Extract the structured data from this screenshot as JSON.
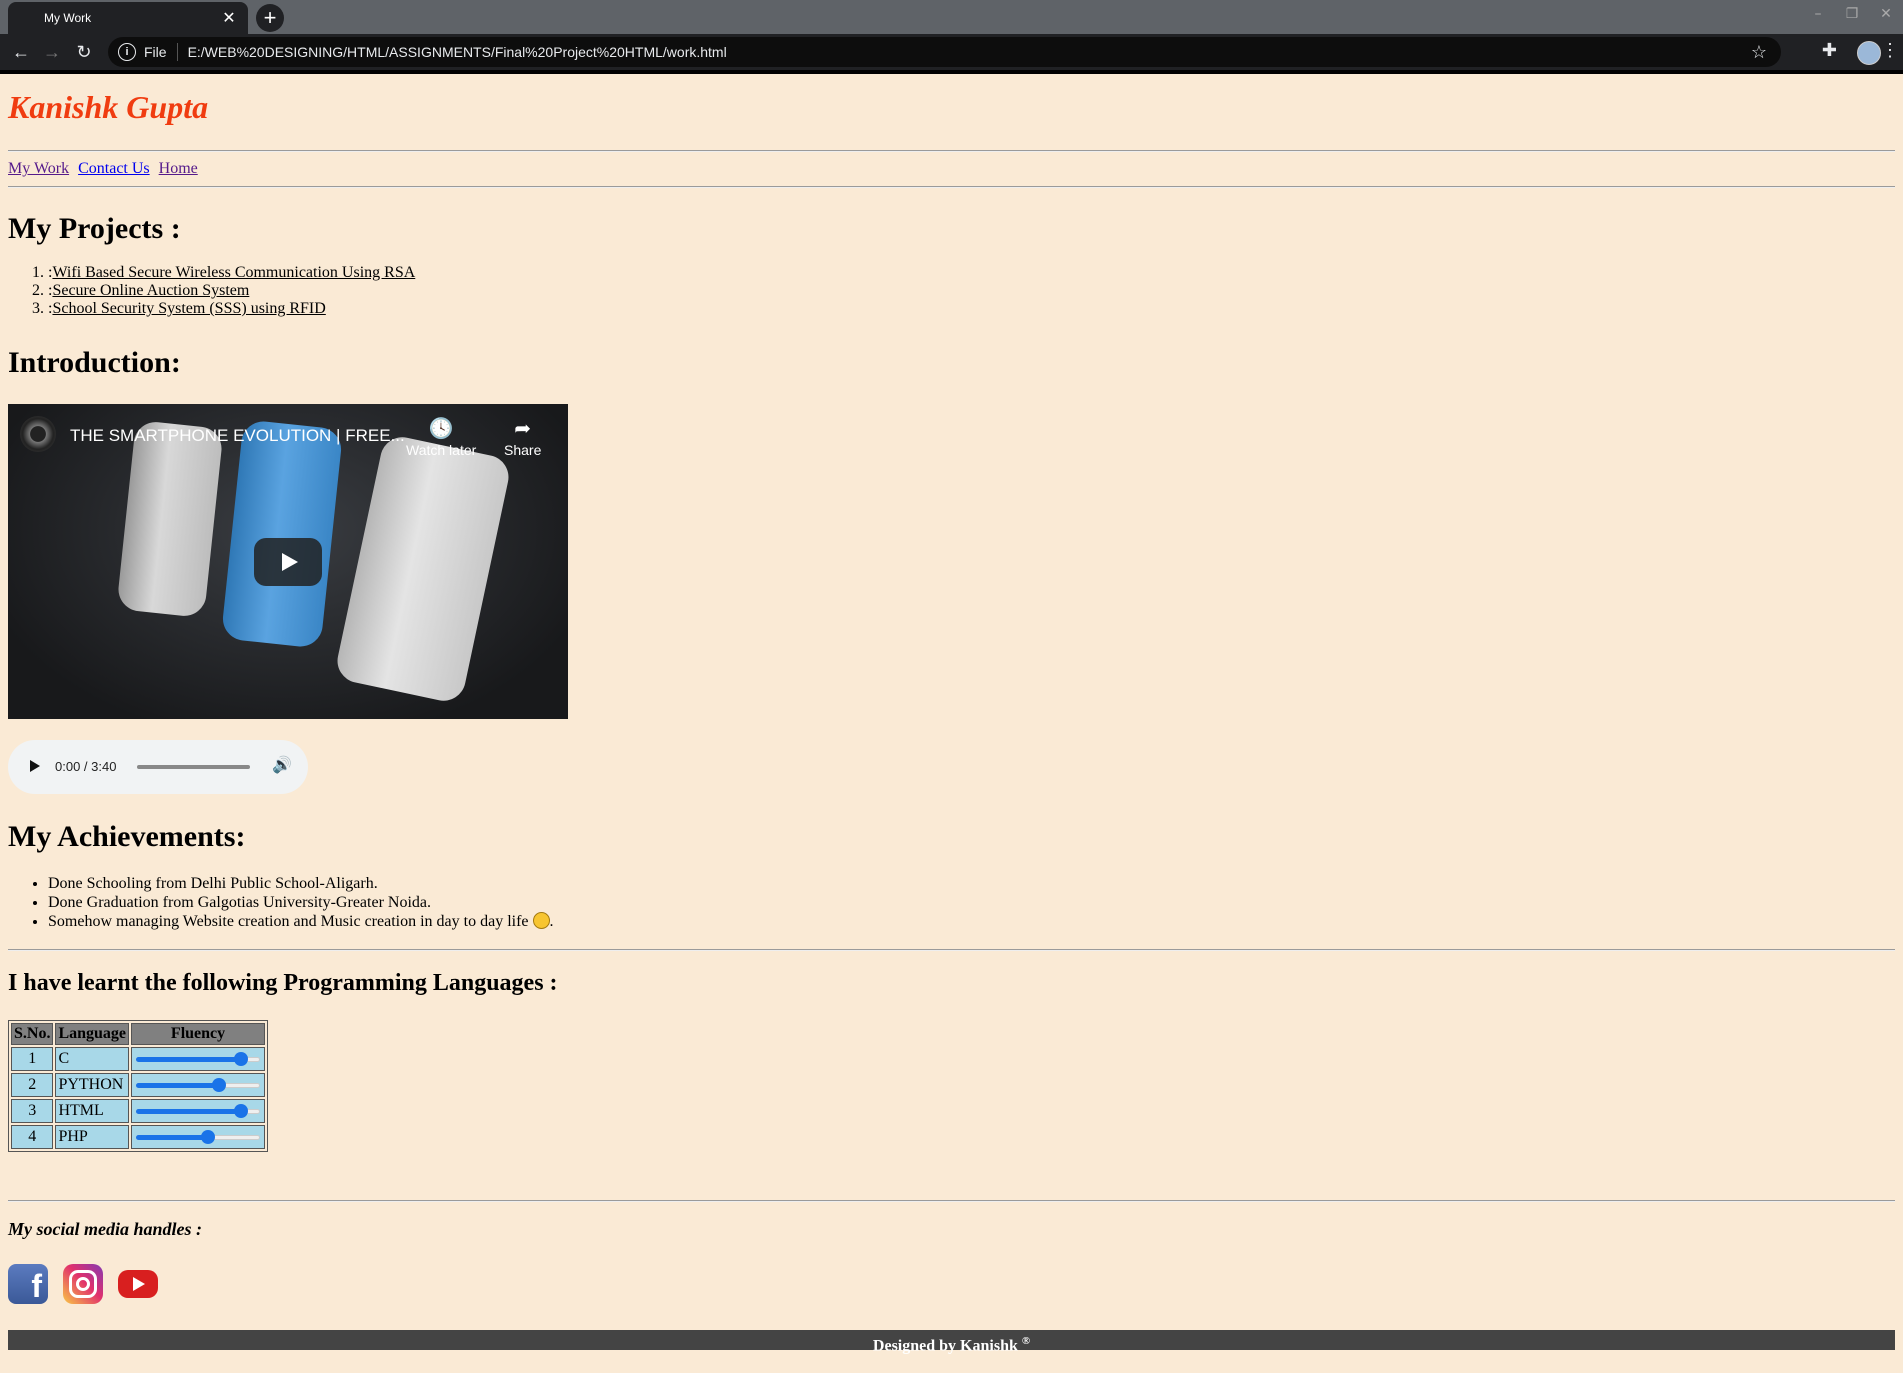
{
  "browser": {
    "tab_title": "My Work",
    "tab_close": "✕",
    "new_tab": "+",
    "scheme_label": "File",
    "url": "E:/WEB%20DESIGNING/HTML/ASSIGNMENTS/Final%20Project%20HTML/work.html"
  },
  "site": {
    "title": "Kanishk Gupta",
    "nav": [
      "My Work",
      "Contact Us",
      "Home"
    ]
  },
  "projects": {
    "heading": "My Projects :",
    "items": [
      "Wifi Based Secure Wireless Communication Using RSA",
      "Secure Online Auction System",
      "School Security System (SSS) using RFID"
    ],
    "item_prefix": ":"
  },
  "intro": {
    "heading": "Introduction:",
    "video": {
      "title": "THE SMARTPHONE EVOLUTION | FREE...",
      "watch_later": "Watch later",
      "share": "Share"
    },
    "audio": {
      "time": "0:00 / 3:40",
      "progress": 0
    }
  },
  "achievements": {
    "heading": "My Achievements:",
    "items": [
      "Done Schooling from Delhi Public School-Aligarh.",
      "Done Graduation from Galgotias University-Greater Noida.",
      "Somehow managing Website creation and Music creation in day to day life"
    ],
    "last_suffix": "."
  },
  "languages": {
    "heading": "I have learnt the following Programming Languages :",
    "columns": [
      "S.No.",
      "Language",
      "Fluency"
    ],
    "rows": [
      {
        "sno": "1",
        "language": "C",
        "fluency": 0.95
      },
      {
        "sno": "2",
        "language": "PYTHON",
        "fluency": 0.75
      },
      {
        "sno": "3",
        "language": "HTML",
        "fluency": 0.95
      },
      {
        "sno": "4",
        "language": "PHP",
        "fluency": 0.65
      }
    ]
  },
  "social": {
    "heading": "My social media handles :",
    "icons": [
      "facebook-icon",
      "instagram-icon",
      "youtube-icon"
    ],
    "fb_glyph": "f"
  },
  "footer": {
    "text": "Designed by Kanishk",
    "mark": "®"
  },
  "colors": {
    "page_bg": "#faead5",
    "title": "#f03c10",
    "table_cell": "#a8d8e8",
    "table_header": "#808080",
    "footer_bg": "#444444"
  }
}
